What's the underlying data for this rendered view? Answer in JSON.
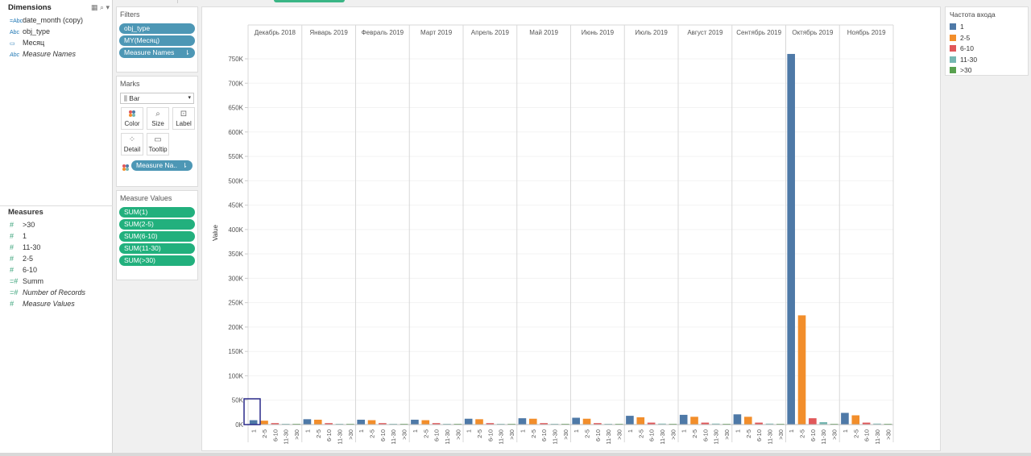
{
  "data_pane": {
    "dimensions_title": "Dimensions",
    "tools": "▦ ⌕ ▾",
    "dimensions": [
      {
        "icon": "=Abc",
        "label": "date_month (copy)",
        "italic": false
      },
      {
        "icon": "Abc",
        "label": "obj_type",
        "italic": false
      },
      {
        "icon": "▭",
        "label": "Месяц",
        "italic": false
      },
      {
        "icon": "Abc",
        "label": "Measure Names",
        "italic": true
      }
    ],
    "measures_title": "Measures",
    "measures": [
      {
        "icon": "#",
        "label": ">30",
        "italic": false
      },
      {
        "icon": "#",
        "label": "1",
        "italic": false
      },
      {
        "icon": "#",
        "label": "11-30",
        "italic": false
      },
      {
        "icon": "#",
        "label": "2-5",
        "italic": false
      },
      {
        "icon": "#",
        "label": "6-10",
        "italic": false
      },
      {
        "icon": "=#",
        "label": "Summ",
        "italic": false
      },
      {
        "icon": "=#",
        "label": "Number of Records",
        "italic": true
      },
      {
        "icon": "#",
        "label": "Measure Values",
        "italic": true
      }
    ]
  },
  "filters": {
    "title": "Filters",
    "pills": [
      "obj_type",
      "MY(Месяц)",
      "Measure Names"
    ]
  },
  "marks": {
    "title": "Marks",
    "mark_type": "Bar",
    "buttons": [
      {
        "label": "Color",
        "icon": "color-icon"
      },
      {
        "label": "Size",
        "icon": "size-icon"
      },
      {
        "label": "Label",
        "icon": "label-icon"
      },
      {
        "label": "Detail",
        "icon": "detail-icon"
      },
      {
        "label": "Tooltip",
        "icon": "tooltip-icon"
      }
    ],
    "pill": "Measure Na.."
  },
  "measure_values": {
    "title": "Measure Values",
    "pills": [
      "SUM(1)",
      "SUM(2-5)",
      "SUM(6-10)",
      "SUM(11-30)",
      "SUM(>30)"
    ]
  },
  "legend": {
    "title": "Частота входа",
    "items": [
      {
        "label": "1",
        "color": "#4e79a7"
      },
      {
        "label": "2-5",
        "color": "#f28e2b"
      },
      {
        "label": "6-10",
        "color": "#e15759"
      },
      {
        "label": "11-30",
        "color": "#76b7b2"
      },
      {
        "label": ">30",
        "color": "#59a14f"
      }
    ]
  },
  "chart_data": {
    "type": "bar",
    "ylabel": "Value",
    "ylim": [
      0,
      750000
    ],
    "yticks": [
      "0K",
      "50K",
      "100K",
      "150K",
      "200K",
      "250K",
      "300K",
      "350K",
      "400K",
      "450K",
      "500K",
      "550K",
      "600K",
      "650K",
      "700K",
      "750K"
    ],
    "grid": false,
    "legend_position": "right",
    "panels": [
      "Декабрь 2018",
      "Январь 2019",
      "Февраль 2019",
      "Март 2019",
      "Апрель 2019",
      "Май 2019",
      "Июнь 2019",
      "Июль 2019",
      "Август 2019",
      "Сентябрь 2019",
      "Октябрь 2019",
      "Ноябрь 2019"
    ],
    "categories": [
      "1",
      "2-5",
      "6-10",
      "11-30",
      ">30"
    ],
    "series": [
      {
        "name": "1",
        "values": [
          9000,
          11000,
          10000,
          10000,
          12000,
          13000,
          14000,
          18000,
          20000,
          21000,
          760000,
          24000
        ]
      },
      {
        "name": "2-5",
        "values": [
          8000,
          10000,
          9000,
          9000,
          11000,
          12000,
          12000,
          15000,
          16000,
          16000,
          224000,
          19000
        ]
      },
      {
        "name": "6-10",
        "values": [
          3000,
          3000,
          3000,
          3000,
          3000,
          3000,
          3000,
          4000,
          4000,
          4000,
          13000,
          4000
        ]
      },
      {
        "name": "11-30",
        "values": [
          1500,
          1500,
          1500,
          1500,
          1500,
          1500,
          1500,
          2000,
          2000,
          2000,
          5000,
          2000
        ]
      },
      {
        "name": ">30",
        "values": [
          300,
          300,
          300,
          300,
          300,
          300,
          300,
          400,
          400,
          400,
          800,
          400
        ]
      }
    ]
  }
}
